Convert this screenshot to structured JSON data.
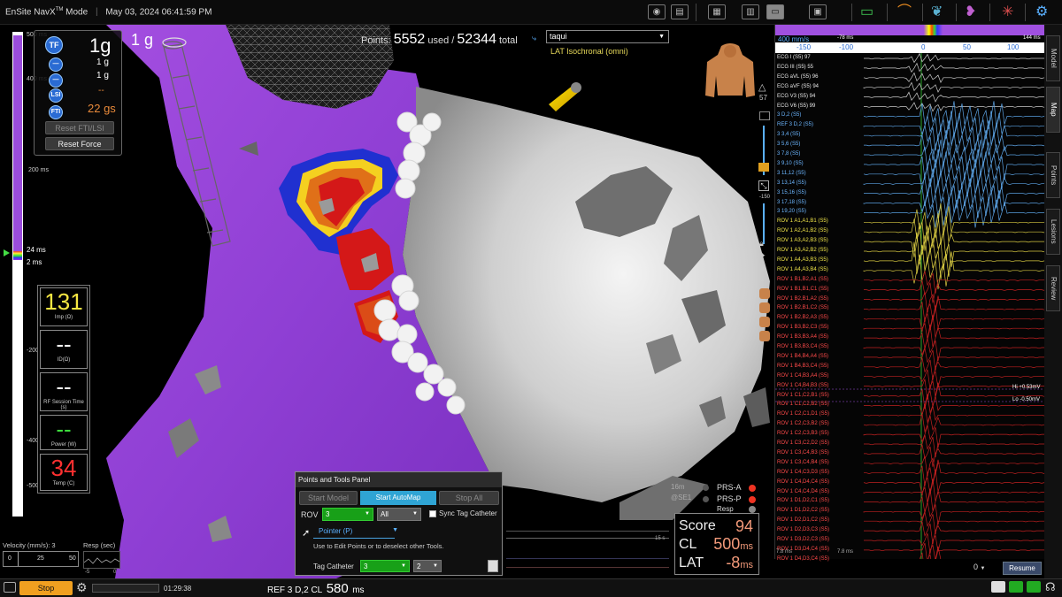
{
  "app": {
    "title_prefix": "EnSite NavX",
    "title_tm": "TM",
    "title_suffix": " Mode",
    "datetime": "May 03, 2024 06:41:59 PM"
  },
  "force_panel": {
    "main_force": "1g",
    "overlay_force": "1 g",
    "rows": [
      {
        "icon": "TF",
        "value": "1g"
      },
      {
        "icon": "—",
        "value": "1 g"
      },
      {
        "icon": "—",
        "value": "1 g"
      },
      {
        "icon": "LSI",
        "value": "--"
      },
      {
        "icon": "FTI",
        "value": "22 gs"
      }
    ],
    "reset_fti_lsi": "Reset FTI/LSI",
    "reset_force": "Reset Force"
  },
  "time_scale": {
    "ticks": [
      "500 ms",
      "400 ms",
      "200 ms",
      "24 ms",
      "2 ms",
      "-200 ms",
      "-400 ms",
      "-500 ms"
    ],
    "marker_24": "24 ms",
    "marker_2": "2 ms"
  },
  "metrics": [
    {
      "value": "131",
      "label": "Imp (Ω)",
      "color": "#f5e642"
    },
    {
      "value": "--",
      "label": "ID(Ω)",
      "color": "#ffffff"
    },
    {
      "value": "--",
      "label": "RF Session Time (s)",
      "color": "#ffffff"
    },
    {
      "value": "--",
      "label": "Power (W)",
      "color": "#3ddc3d"
    },
    {
      "value": "34",
      "label": "Temp (C)",
      "color": "#ff3030"
    }
  ],
  "points": {
    "label": "Points:",
    "used": "5552",
    "used_label": "used /",
    "total": "52344",
    "total_label": "total"
  },
  "map_select": {
    "value": "taqui",
    "subtitle": "LAT Isochronal (omni)"
  },
  "right_tools": {
    "count": "57"
  },
  "resp_indicators": [
    {
      "label": "PRS-A",
      "dot_color": "#e32"
    },
    {
      "label": "PRS-P",
      "dot_color": "#e32"
    },
    {
      "label": "Resp",
      "dot_color": "#888"
    }
  ],
  "small_labels": {
    "tag_a": "16m",
    "tag_b": "@SE1"
  },
  "points_panel": {
    "title": "Points and Tools Panel",
    "start_model": "Start Model",
    "start_automap": "Start AutoMap",
    "stop_all": "Stop All",
    "rov_label": "ROV",
    "rov_value": "3",
    "rov_filter": "All",
    "sync_tag": "Sync Tag Catheter",
    "tool_name": "Pointer (P)",
    "tool_desc": "Use to Edit Points or to deselect other Tools.",
    "tag_label": "Tag Catheter",
    "tag_value": "3",
    "tag_value2": "2",
    "mini_ticks": [
      "1 s",
      "15 s"
    ]
  },
  "score_box": {
    "score_label": "Score",
    "score": "94",
    "cl_label": "CL",
    "cl": "500",
    "cl_unit": "ms",
    "lat_label": "LAT",
    "lat": "-8",
    "lat_unit": "ms"
  },
  "velocity": {
    "label": "Velocity (mm/s): 3",
    "ticks": [
      "0",
      "25",
      "50"
    ],
    "resp_label": "Resp (sec)",
    "resp_ticks": [
      "-5",
      "0"
    ]
  },
  "ecg": {
    "speed": "400 mm/s",
    "ruler_ticks": [
      "-150",
      "-100",
      "0",
      "50",
      "100"
    ],
    "ruler_left": "-78 ms",
    "ruler_right": "144 ms",
    "hi": "Hi +0.53mV",
    "lo": "Lo -0.50mV",
    "bottom_left": "7.8 ms",
    "bottom_right": "7.8 ms",
    "zoom_value": "0",
    "resume": "Resume",
    "channels_white": [
      "ECG I (S5) 97",
      "ECG III (S5) 55",
      "ECG aVL (S5) 96",
      "ECG aVF (S5) 94",
      "ECG V3 (S5) 94",
      "ECG V6 (S5) 99"
    ],
    "channels_blue": [
      "3 D,2 (S5)",
      "REF 3 D,2 (S5)",
      "3 3,4 (S5)",
      "3 5,6 (S5)",
      "3 7,8 (S5)",
      "3 9,10 (S5)",
      "3 11,12 (S5)",
      "3 13,14 (S5)",
      "3 15,16 (S5)",
      "3 17,18 (S5)",
      "3 19,20 (S5)"
    ],
    "channels_yellow": [
      "ROV 1 A1,A1,B1 (S5)",
      "ROV 1 A2,A1,B2 (S5)",
      "ROV 1 A3,A2,B3 (S5)",
      "ROV 1 A3,A2,B2 (S5)",
      "ROV 1 A4,A3,B3 (S5)",
      "ROV 1 A4,A3,B4 (S5)"
    ],
    "channels_red": [
      "ROV 1 B1,B2,A1 (S5)",
      "ROV 1 B1,B1,C1 (S5)",
      "ROV 1 B2,B1,A2 (S5)",
      "ROV 1 B2,B1,C2 (S5)",
      "ROV 1 B2,B2,A3 (S5)",
      "ROV 1 B3,B2,C3 (S5)",
      "ROV 1 B3,B3,A4 (S5)",
      "ROV 1 B3,B3,C4 (S5)",
      "ROV 1 B4,B4,A4 (S5)",
      "ROV 1 B4,B3,C4 (S5)",
      "ROV 1 C4,B3,A4 (S5)",
      "ROV 1 C4,B4,B3 (S5)",
      "ROV 1 C1,C2,B1 (S5)",
      "ROV 1 C1,C2,B2 (S5)",
      "ROV 1 C2,C1,D1 (S5)",
      "ROV 1 C2,C3,B2 (S5)",
      "ROV 1 C2,C3,B3 (S5)",
      "ROV 1 C3,C2,D2 (S5)",
      "ROV 1 C3,C4,B3 (S5)",
      "ROV 1 C3,C4,B4 (S5)",
      "ROV 1 C4,C3,D3 (S5)",
      "ROV 1 C4,D4,C4 (S5)",
      "ROV 1 C4,C4,D4 (S5)",
      "ROV 1 D1,D2,C1 (S5)",
      "ROV 1 D1,D2,C2 (S5)",
      "ROV 1 D2,D1,C2 (S5)",
      "ROV 1 D2,D3,C3 (S5)",
      "ROV 1 D3,D2,C3 (S5)",
      "ROV 1 D3,D4,C4 (S5)",
      "ROV 1 D4,D3,C4 (S5)"
    ]
  },
  "right_tabs": [
    "Model",
    "Map",
    "Points",
    "Lesions",
    "Review"
  ],
  "bottom_bar": {
    "stop": "Stop",
    "elapsed": "01:29:38",
    "ref_label": "REF 3 D,2 CL",
    "ref_value": "580",
    "ref_unit": "ms"
  },
  "toolbar_icons": [
    "camera-icon",
    "print-icon",
    "layout-a-icon",
    "layout-b-icon",
    "layout-c-icon",
    "window-icon",
    "monitor-icon",
    "catheter-icon",
    "map-view-icon",
    "heart-icon",
    "ablation-icon",
    "settings-icon"
  ]
}
